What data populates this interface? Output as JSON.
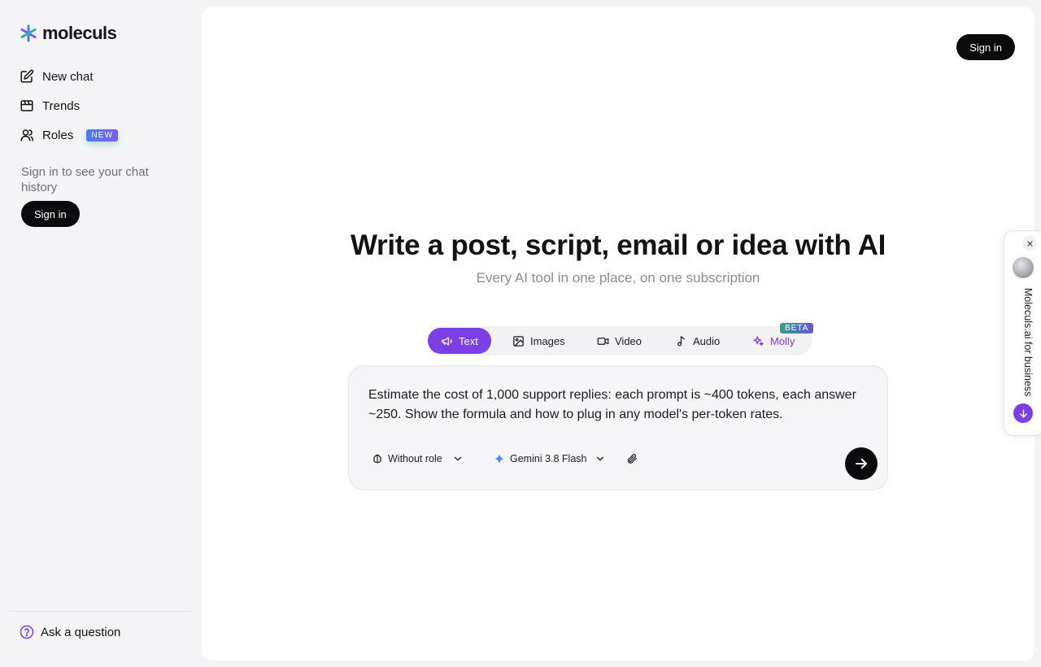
{
  "app": {
    "logo_text": "moleculs"
  },
  "sidebar": {
    "items": [
      {
        "label": "New chat",
        "icon": "edit-icon"
      },
      {
        "label": "Trends",
        "icon": "film-icon"
      },
      {
        "label": "Roles",
        "icon": "user-icon",
        "badge": "NEW"
      }
    ],
    "signin_hint": "Sign in to see your chat history",
    "signin_label": "Sign in",
    "ask_label": "Ask a question"
  },
  "header": {
    "signin_label": "Sign in"
  },
  "hero": {
    "title": "Write a post, script, email or idea with AI",
    "subtitle": "Every AI tool in one place, on one subscription"
  },
  "tabs": [
    {
      "label": "Text",
      "icon": "megaphone-icon",
      "active": true
    },
    {
      "label": "Images",
      "icon": "image-icon"
    },
    {
      "label": "Video",
      "icon": "video-icon"
    },
    {
      "label": "Audio",
      "icon": "music-note-icon"
    },
    {
      "label": "Molly",
      "icon": "sparkles-icon",
      "badge": "BETA"
    }
  ],
  "composer": {
    "prompt": "Estimate the cost of 1,000 support replies: each prompt is ~400 tokens, each answer ~250. Show the formula and how to plug in any model's per-token rates.",
    "role_label": "Without role",
    "model_label": "Gemini 3.8 Flash"
  },
  "widget": {
    "label": "Moleculs.ai for business"
  },
  "colors": {
    "accent": "#7b3fe4",
    "dark": "#0b0b0e",
    "background": "#f4f4f6"
  }
}
